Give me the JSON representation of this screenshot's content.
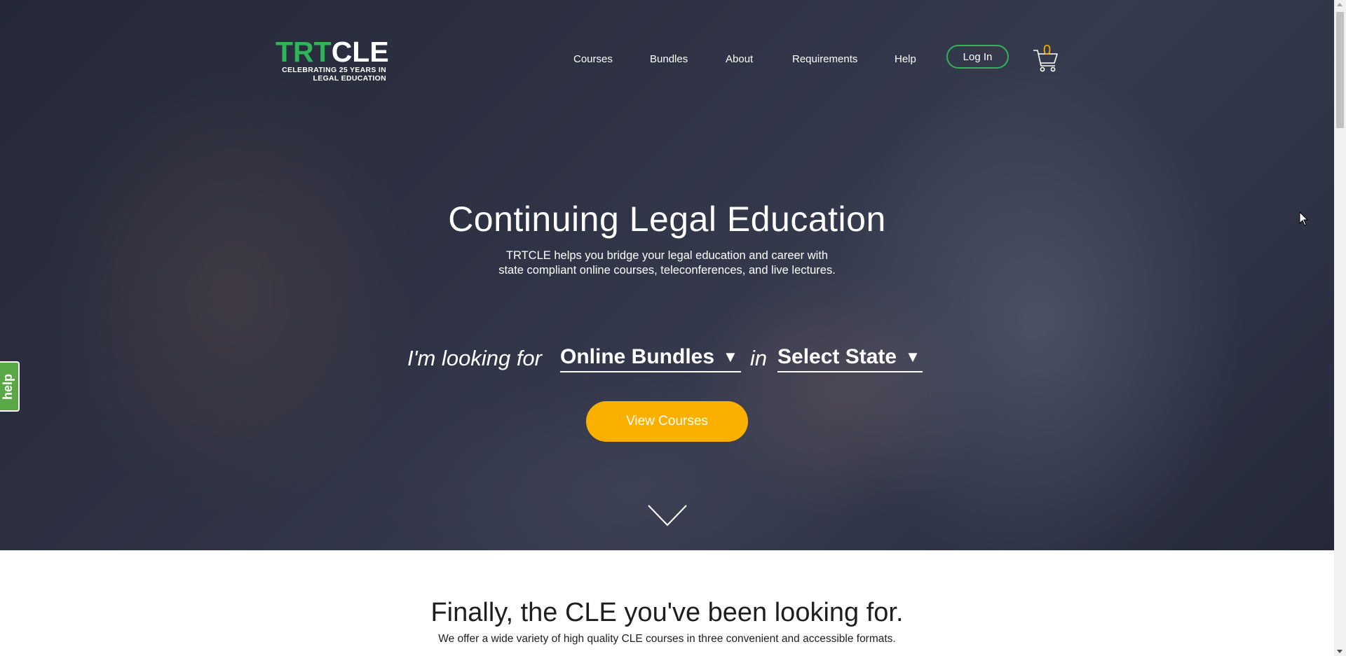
{
  "header": {
    "logo_green": "TRT",
    "logo_white": "CLE",
    "logo_tagline_1": "CELEBRATING 25 YEARS IN",
    "logo_tagline_2": "LEGAL EDUCATION",
    "nav": [
      {
        "label": "Courses"
      },
      {
        "label": "Bundles"
      },
      {
        "label": "About"
      },
      {
        "label": "Requirements"
      },
      {
        "label": "Help"
      }
    ],
    "login_label": "Log In",
    "cart_count": "0"
  },
  "hero": {
    "title": "Continuing Legal Education",
    "subtitle_line1": "TRTCLE helps you bridge your legal education and career with",
    "subtitle_line2": "state compliant online courses, teleconferences, and live lectures.",
    "finder_prefix": "I'm looking for",
    "finder_type_value": "Online Bundles",
    "finder_connector": "in",
    "finder_state_value": "Select State",
    "cta_label": "View Courses"
  },
  "help_tab": {
    "label": "help"
  },
  "intro": {
    "title": "Finally, the CLE you've been looking for.",
    "subtitle": "We offer a wide variety of high quality CLE courses in three convenient and accessible formats."
  },
  "colors": {
    "brand_green": "#2fb45a",
    "accent_yellow": "#fbb000",
    "help_green": "#5aa845"
  }
}
